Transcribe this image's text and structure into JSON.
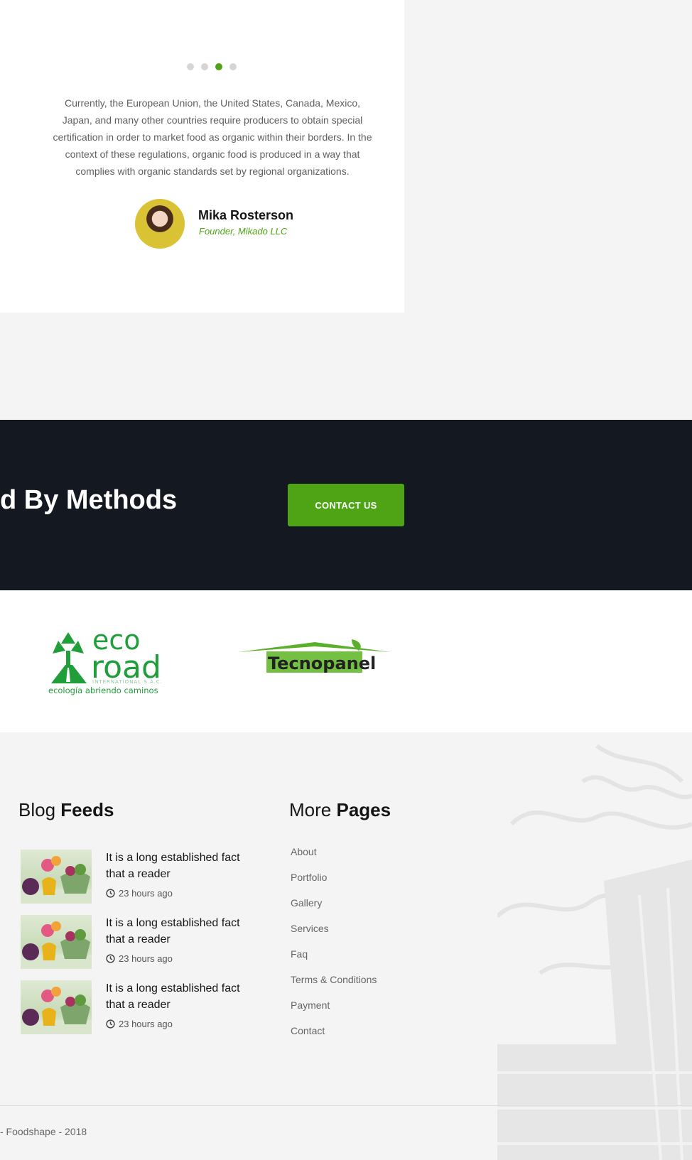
{
  "testimonial": {
    "dots": [
      false,
      false,
      true,
      false
    ],
    "quote": "Currently, the European Union, the United States, Canada, Mexico, Japan, and many other countries require producers to obtain special certification in order to market food as organic within their borders. In the context of these regulations, organic food is produced in a way that complies with organic standards set by regional organizations.",
    "name": "Mika Rosterson",
    "role": "Founder, Mikado LLC"
  },
  "cta": {
    "heading": "d By Methods",
    "button_label": "CONTACT US"
  },
  "partners": {
    "eco_road": {
      "word1": "eco",
      "word2": "road",
      "sub": "INTERNATIONAL S.A.C.",
      "tagline": "ecología abriendo caminos"
    },
    "tecno_panel": {
      "text": "Tecnopanel"
    }
  },
  "footer": {
    "blog": {
      "title_light": "Blog",
      "title_bold": "Feeds",
      "items": [
        {
          "headline": "It is a long established fact that a reader",
          "time": "23 hours ago"
        },
        {
          "headline": "It is a long established fact that a reader",
          "time": "23 hours ago"
        },
        {
          "headline": "It is a long established fact that a reader",
          "time": "23 hours ago"
        }
      ]
    },
    "pages": {
      "title_light": "More",
      "title_bold": "Pages",
      "links": [
        "About",
        "Portfolio",
        "Gallery",
        "Services",
        "Faq",
        "Terms & Conditions",
        "Payment",
        "Contact"
      ]
    },
    "copyright": "- Foodshape - 2018"
  },
  "colors": {
    "accent": "#4ea415",
    "dark_band": "#141820",
    "footer_bg": "#f4f4f4"
  }
}
